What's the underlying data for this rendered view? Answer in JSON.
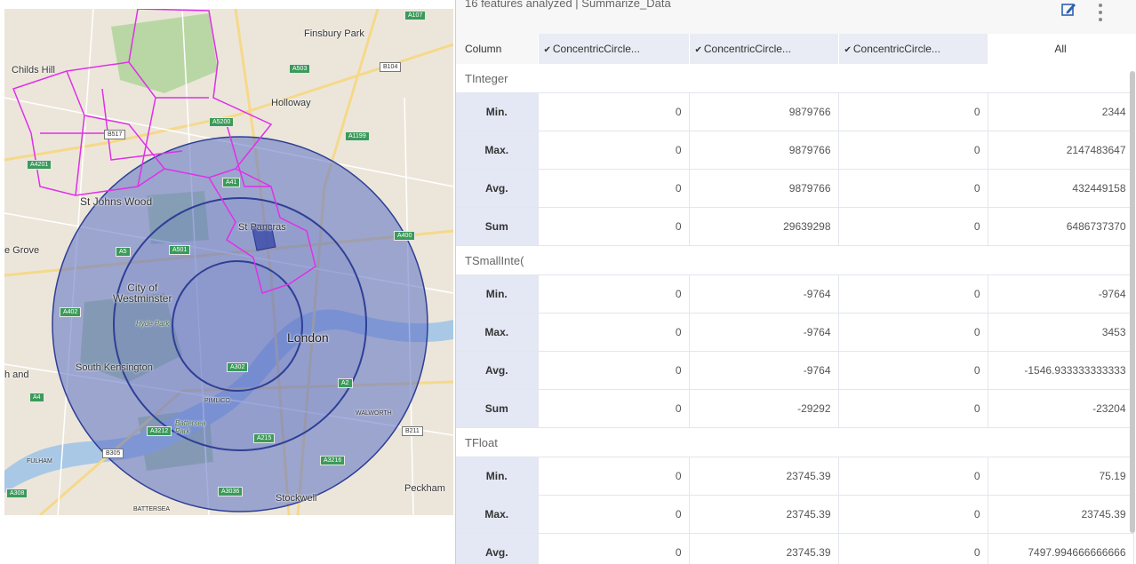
{
  "map": {
    "labels": {
      "finsbury_park": "Finsbury Park",
      "childs_hill": "Childs Hill",
      "holloway": "Holloway",
      "st_johns_wood": "St Johns Wood",
      "st_pancras": "St Pancras",
      "grove": "e Grove",
      "city_of_westminster": "City of\nWestminster",
      "hyde_park": "Hyde Park",
      "london": "London",
      "south_kensington": "South Kensington",
      "h_and": "h and",
      "pimlico": "PIMLICO",
      "peckham": "Peckham",
      "stockwell": "Stockwell",
      "battersea": "BATTERSEA",
      "battersea_park": "Battersea\nPark",
      "fulham": "FULHAM",
      "walworth": "WALWORTH"
    },
    "road_badges": [
      "A107",
      "A503",
      "B104",
      "A5200",
      "A1199",
      "B517",
      "A4201",
      "A41",
      "A501",
      "A400",
      "A5",
      "A402",
      "A4",
      "A302",
      "A3212",
      "A3036",
      "A2",
      "B211",
      "A215",
      "A3216",
      "B305",
      "A308"
    ],
    "colors": {
      "buffer_fill": "#5b6fc4",
      "buffer_stroke": "#2e3f96",
      "boundary": "#e030e8",
      "park": "#b9d7a4",
      "water": "#a8c8e6"
    }
  },
  "panel": {
    "title": "16 features analyzed | Summarize_Data",
    "icons": {
      "edit": "edit-icon",
      "more": "more-vertical-icon"
    }
  },
  "table": {
    "column_header": "Column",
    "columns": [
      "ConcentricCircle...",
      "ConcentricCircle...",
      "ConcentricCircle...",
      "All"
    ],
    "check": "✔",
    "groups": [
      {
        "name": "TInteger",
        "rows": [
          {
            "stat": "Min.",
            "values": [
              "0",
              "9879766",
              "0",
              "2344"
            ]
          },
          {
            "stat": "Max.",
            "values": [
              "0",
              "9879766",
              "0",
              "2147483647"
            ]
          },
          {
            "stat": "Avg.",
            "values": [
              "0",
              "9879766",
              "0",
              "432449158"
            ]
          },
          {
            "stat": "Sum",
            "values": [
              "0",
              "29639298",
              "0",
              "6486737370"
            ]
          }
        ]
      },
      {
        "name": "TSmallInte(",
        "rows": [
          {
            "stat": "Min.",
            "values": [
              "0",
              "-9764",
              "0",
              "-9764"
            ]
          },
          {
            "stat": "Max.",
            "values": [
              "0",
              "-9764",
              "0",
              "3453"
            ]
          },
          {
            "stat": "Avg.",
            "values": [
              "0",
              "-9764",
              "0",
              "-1546.933333333333"
            ]
          },
          {
            "stat": "Sum",
            "values": [
              "0",
              "-29292",
              "0",
              "-23204"
            ]
          }
        ]
      },
      {
        "name": "TFloat",
        "rows": [
          {
            "stat": "Min.",
            "values": [
              "0",
              "23745.39",
              "0",
              "75.19"
            ]
          },
          {
            "stat": "Max.",
            "values": [
              "0",
              "23745.39",
              "0",
              "23745.39"
            ]
          },
          {
            "stat": "Avg.",
            "values": [
              "0",
              "23745.39",
              "0",
              "7497.994666666666"
            ]
          }
        ]
      }
    ]
  }
}
